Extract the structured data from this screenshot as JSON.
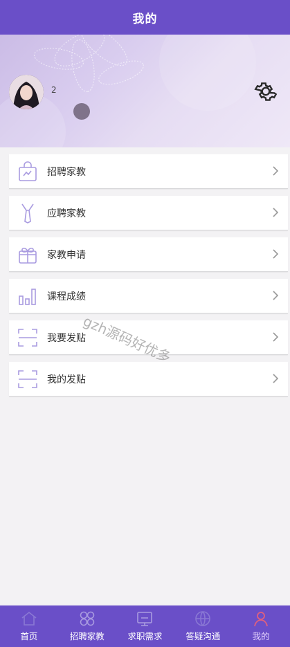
{
  "header": {
    "title": "我的"
  },
  "profile": {
    "username": "2"
  },
  "menu": {
    "items": [
      {
        "label": "招聘家教",
        "icon": "shopping-bag-icon"
      },
      {
        "label": "应聘家教",
        "icon": "tie-icon"
      },
      {
        "label": "家教申请",
        "icon": "gift-icon"
      },
      {
        "label": "课程成绩",
        "icon": "bar-chart-icon"
      },
      {
        "label": "我要发贴",
        "icon": "scan-frame-icon"
      },
      {
        "label": "我的发贴",
        "icon": "scan-frame-icon"
      }
    ]
  },
  "watermark": "gzh源码好优多",
  "tabbar": {
    "items": [
      {
        "label": "首页",
        "icon": "home-icon"
      },
      {
        "label": "招聘家教",
        "icon": "grid-clover-icon"
      },
      {
        "label": "求职需求",
        "icon": "screen-icon"
      },
      {
        "label": "答疑沟通",
        "icon": "globe-icon"
      },
      {
        "label": "我的",
        "icon": "user-icon"
      }
    ],
    "active_index": 4
  },
  "colors": {
    "primary": "#6a4fc8",
    "icon_accent": "#a99be0"
  }
}
